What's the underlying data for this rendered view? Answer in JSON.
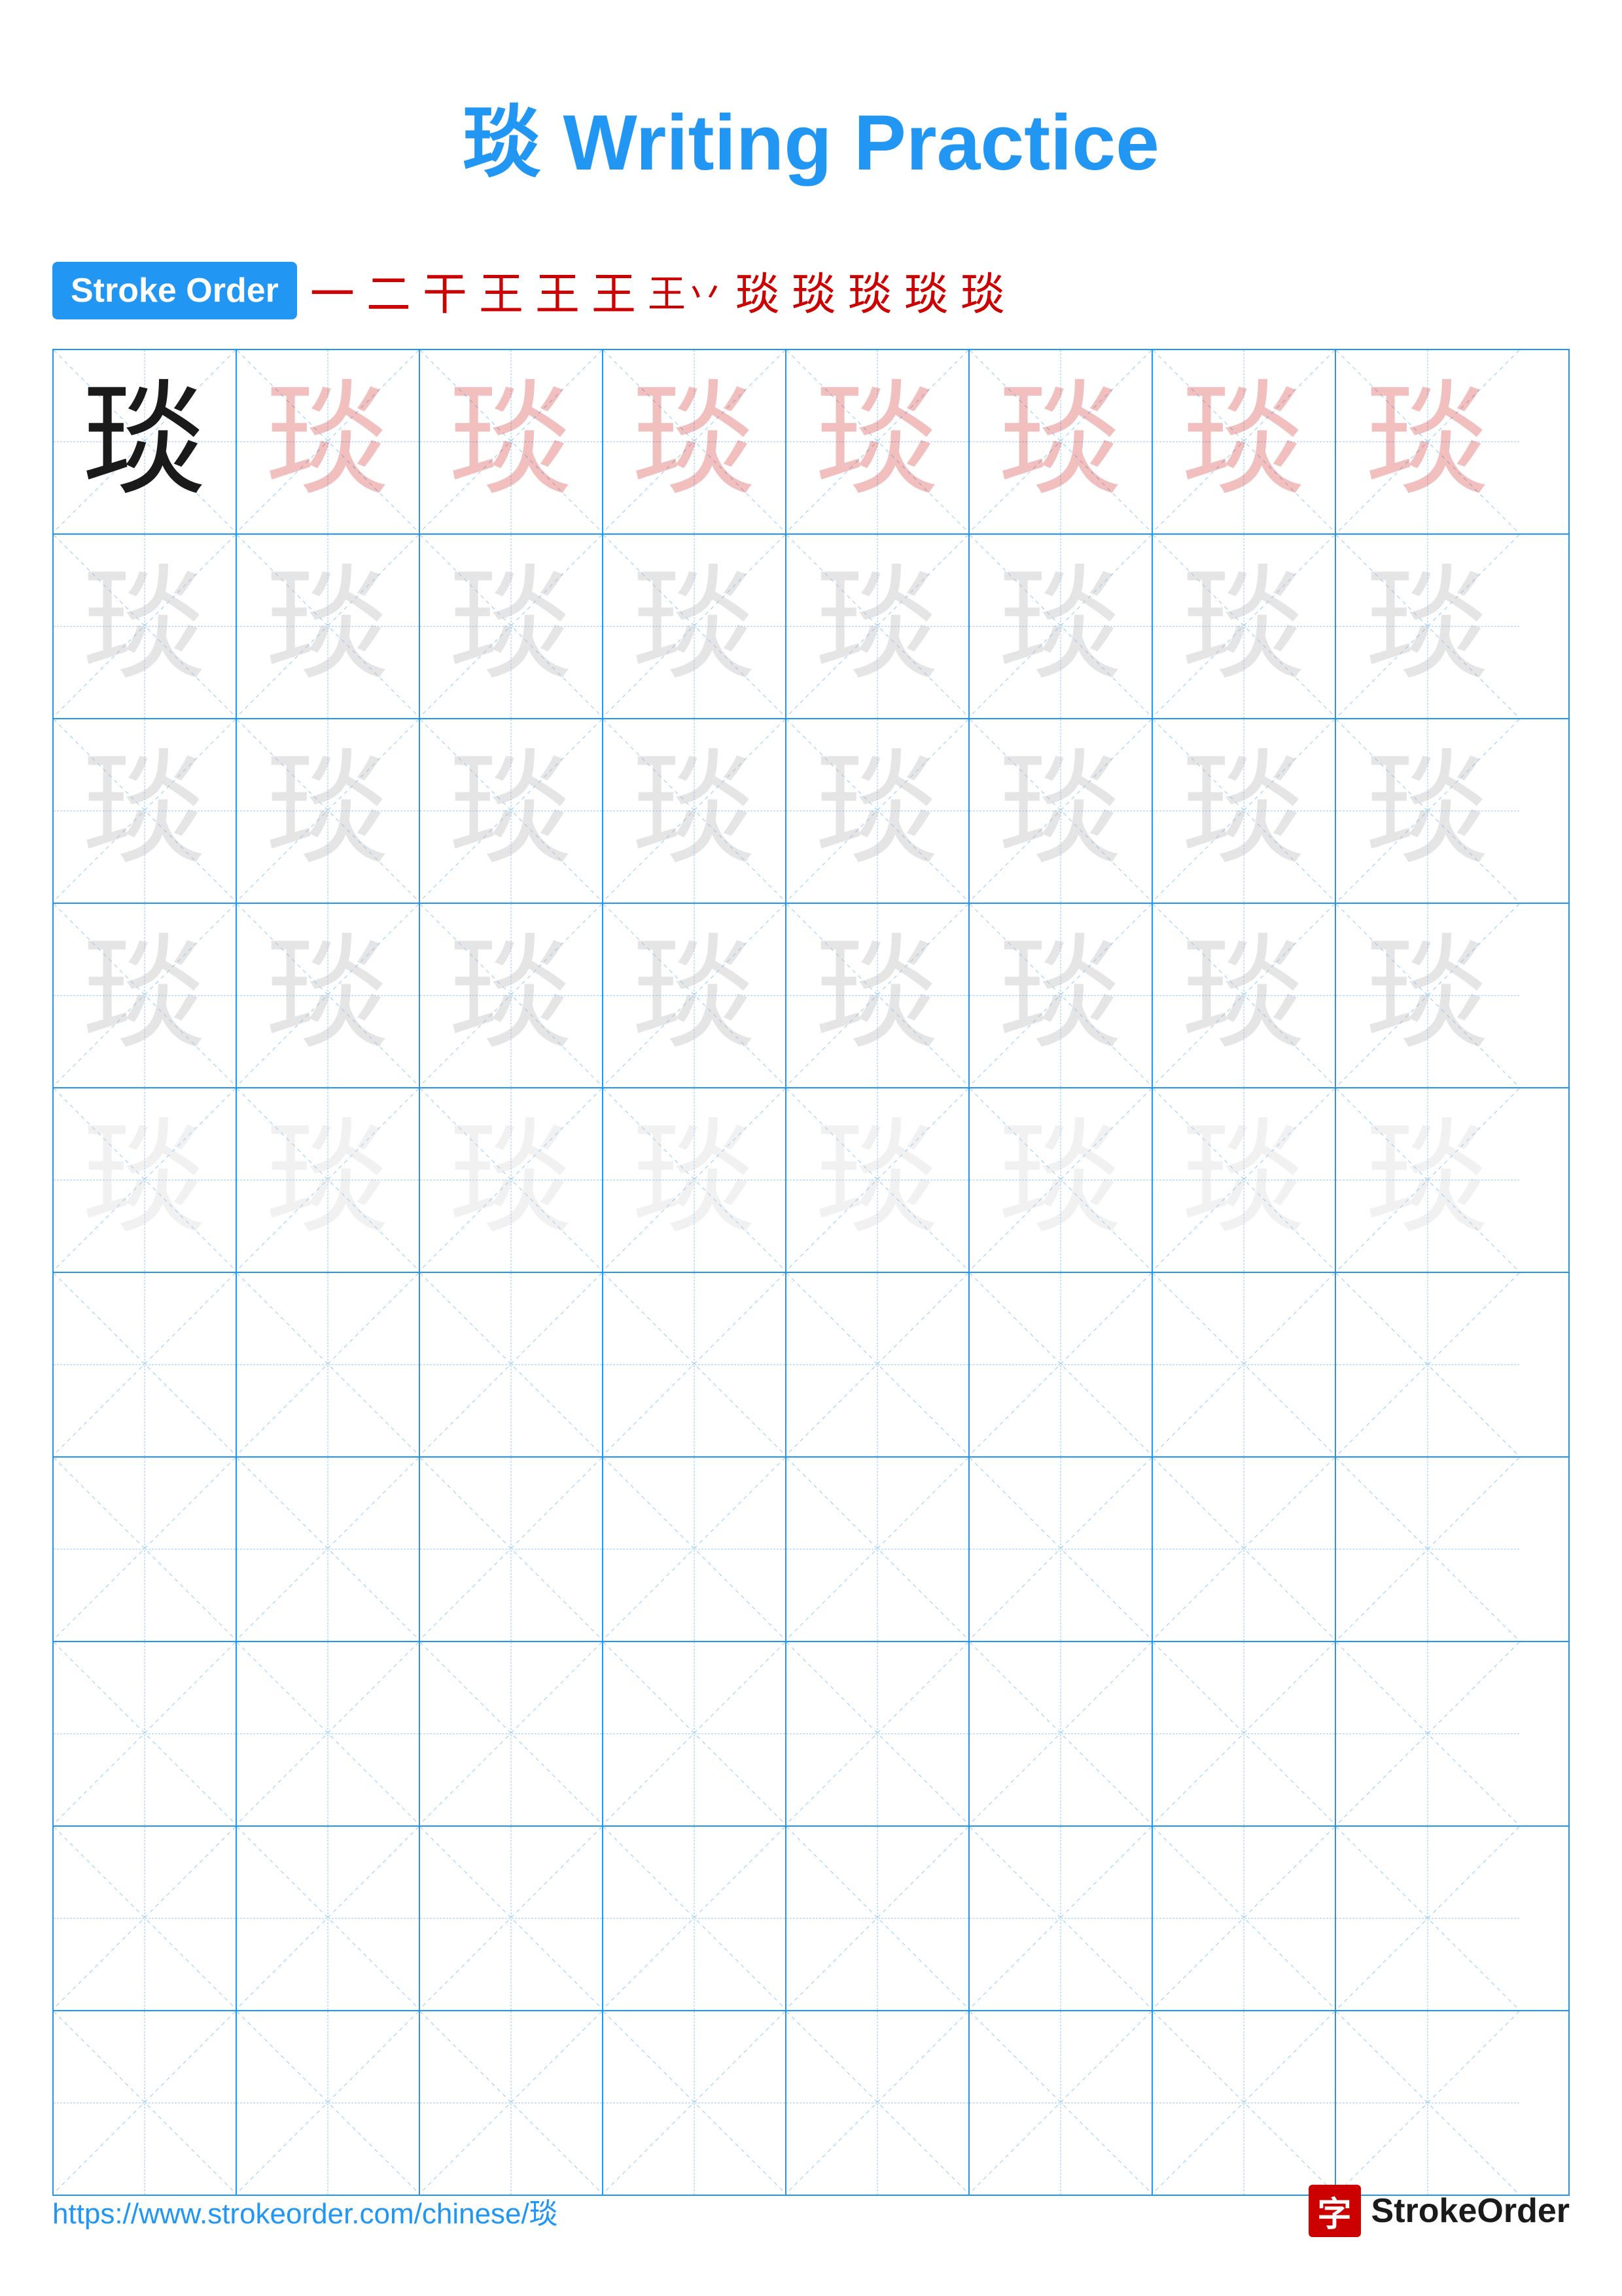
{
  "page": {
    "title": "琰 Writing Practice",
    "character": "琰",
    "stroke_order_label": "Stroke Order",
    "stroke_steps": [
      "一",
      "二",
      "干",
      "王",
      "王",
      "王·",
      "王丷",
      "琰",
      "琰",
      "琰",
      "琰",
      "琰"
    ],
    "footer_url": "https://www.strokeorder.com/chinese/琰",
    "footer_logo_char": "字",
    "footer_logo_name": "StrokeOrder"
  },
  "grid": {
    "rows": 10,
    "cols": 8,
    "practice_rows": 5,
    "empty_rows": 5
  }
}
